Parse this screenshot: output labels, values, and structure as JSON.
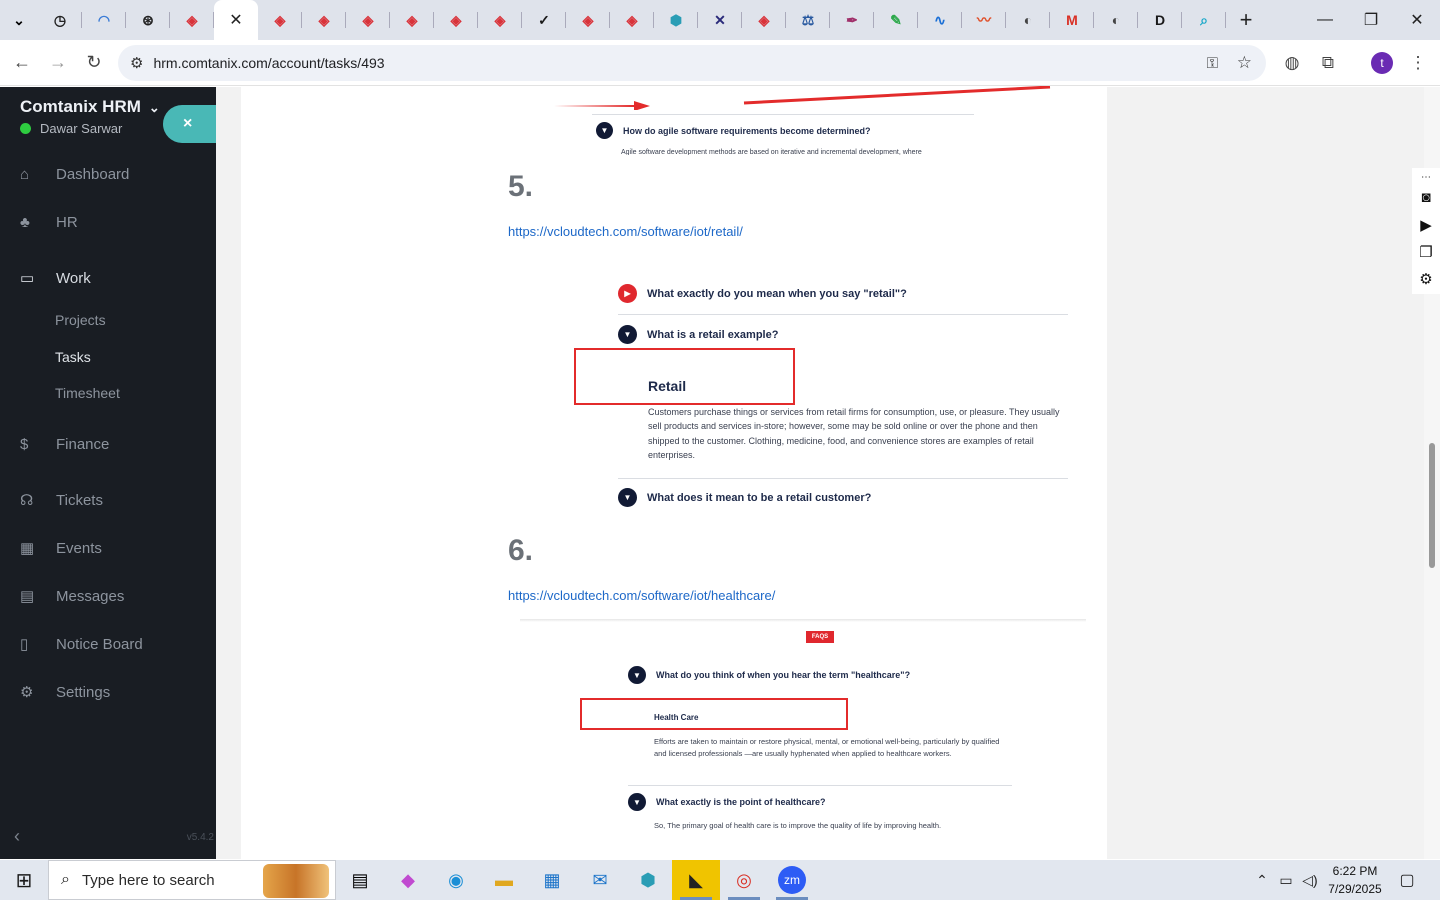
{
  "browser": {
    "tabs": [
      {
        "icon": "clock-app-icon",
        "glyph": "◷",
        "color": "#222222"
      },
      {
        "icon": "wifi-arc-icon",
        "glyph": "◠",
        "color": "#3b7cd6"
      },
      {
        "icon": "openai-icon",
        "glyph": "⊛",
        "color": "#222222"
      },
      {
        "icon": "diamond-site-icon",
        "glyph": "◈",
        "color": "#d9333a"
      },
      {
        "icon": "diamond-site-icon",
        "glyph": "◈",
        "color": "#d9333a"
      },
      {
        "icon": "diamond-site-icon",
        "glyph": "◈",
        "color": "#d9333a"
      },
      {
        "icon": "diamond-site-icon",
        "glyph": "◈",
        "color": "#d9333a"
      },
      {
        "icon": "diamond-site-icon",
        "glyph": "◈",
        "color": "#d9333a"
      },
      {
        "icon": "diamond-site-icon",
        "glyph": "◈",
        "color": "#d9333a"
      },
      {
        "icon": "diamond-site-icon",
        "glyph": "◈",
        "color": "#d9333a"
      },
      {
        "icon": "check-v-icon",
        "glyph": "✓",
        "color": "#1a1a1a"
      },
      {
        "icon": "diamond-site-icon",
        "glyph": "◈",
        "color": "#d9333a"
      },
      {
        "icon": "diamond-site-icon",
        "glyph": "◈",
        "color": "#d9333a"
      },
      {
        "icon": "hexagon-app-icon",
        "glyph": "⬢",
        "color": "#2a9db5"
      },
      {
        "icon": "x-brand-icon",
        "glyph": "✕",
        "color": "#2a2a7a"
      },
      {
        "icon": "diamond-site-icon",
        "glyph": "◈",
        "color": "#d9333a"
      },
      {
        "icon": "scales-icon",
        "glyph": "⚖",
        "color": "#2a5aa0"
      },
      {
        "icon": "fountain-pen-icon",
        "glyph": "✒",
        "color": "#a0306a"
      },
      {
        "icon": "colorful-pen-icon",
        "glyph": "✎",
        "color": "#2ba84a"
      },
      {
        "icon": "pulse-icon",
        "glyph": "∿",
        "color": "#1a6fd6"
      },
      {
        "icon": "scribble-icon",
        "glyph": "〰",
        "color": "#e0502a"
      },
      {
        "icon": "globe-icon",
        "glyph": "◐",
        "color": "#444444"
      },
      {
        "icon": "gmail-icon",
        "glyph": "M",
        "color": "#d93025"
      },
      {
        "icon": "globe-icon",
        "glyph": "◐",
        "color": "#444444"
      },
      {
        "icon": "d-brand-icon",
        "glyph": "D",
        "color": "#1a1a1a"
      },
      {
        "icon": "search-app-icon",
        "glyph": "⌕",
        "color": "#19a8c9"
      }
    ],
    "url": "hrm.comtanix.com/account/tasks/493"
  },
  "sidebar": {
    "brand": "Comtanix HRM",
    "user": "Dawar Sarwar",
    "close_label": "×",
    "items": [
      {
        "label": "Dashboard",
        "icon": "home-icon",
        "glyph": "⌂"
      },
      {
        "label": "HR",
        "icon": "people-icon",
        "glyph": "♣"
      },
      {
        "label": "Work",
        "icon": "briefcase-icon",
        "glyph": "▭"
      },
      {
        "label": "Finance",
        "icon": "dollar-icon",
        "glyph": "$"
      },
      {
        "label": "Tickets",
        "icon": "headset-icon",
        "glyph": "☊"
      },
      {
        "label": "Events",
        "icon": "calendar-icon",
        "glyph": "▦"
      },
      {
        "label": "Messages",
        "icon": "message-icon",
        "glyph": "▤"
      },
      {
        "label": "Notice Board",
        "icon": "clipboard-icon",
        "glyph": "▯"
      },
      {
        "label": "Settings",
        "icon": "gear-icon",
        "glyph": "⚙"
      }
    ],
    "sub_items": [
      "Projects",
      "Tasks",
      "Timesheet"
    ],
    "version": "v5.4.2"
  },
  "content": {
    "top_faq": {
      "question": "How do agile software requirements become determined?",
      "partial": "Agile software development methods are based on iterative and incremental development, where"
    },
    "section5": {
      "number": "5.",
      "link": "https://vcloudtech.com/software/iot/retail/",
      "faq1": "What exactly do you mean when you say \"retail\"?",
      "faq2": "What is a retail example?",
      "heading": "Retail",
      "paragraph": "Customers purchase things or services from retail firms for consumption, use, or pleasure. They usually sell products and services in-store; however, some may be sold online or over the phone and then shipped to the customer. Clothing, medicine, food, and convenience stores are examples of retail enterprises.",
      "faq3": "What does it mean to be a retail customer?"
    },
    "section6": {
      "number": "6.",
      "link": "https://vcloudtech.com/software/iot/healthcare/",
      "tag": "FAQS",
      "faq1": "What do you think of when you hear the term \"healthcare\"?",
      "heading": "Health Care",
      "paragraph": "Efforts are taken to maintain or restore physical, mental, or emotional well-being, particularly by qualified and licensed professionals —are usually hyphenated when applied to healthcare workers.",
      "faq2": "What exactly is the point of healthcare?",
      "partial": "So, The primary goal of health care is to improve the quality of life by improving health."
    }
  },
  "taskbar": {
    "search_placeholder": "Type here to search",
    "time": "6:22 PM",
    "date": "7/29/2025"
  },
  "colors": {
    "sidebar_bg": "#191d23",
    "accent_teal": "#49b8b6",
    "link_blue": "#1d68c8",
    "highlight_red": "#e32b2b"
  }
}
